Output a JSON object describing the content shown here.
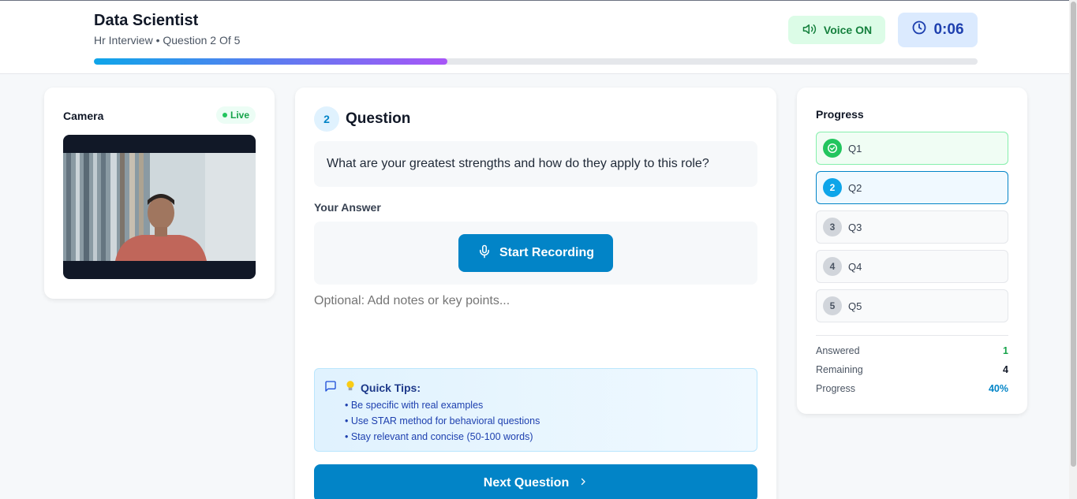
{
  "header": {
    "title": "Data Scientist",
    "subtitle": "Hr Interview • Question 2 Of 5",
    "voice_label": "Voice ON",
    "timer": "0:06",
    "progress_fraction": 0.4
  },
  "camera": {
    "label": "Camera",
    "status": "Live"
  },
  "question": {
    "number": "2",
    "heading": "Question",
    "text": "What are your greatest strengths and how do they apply to this role?",
    "answer_label": "Your Answer",
    "record_button": "Start Recording",
    "notes_placeholder": "Optional: Add notes or key points...",
    "tips_title": "Quick Tips:",
    "tips": [
      "• Be specific with real examples",
      "• Use STAR method for behavioral questions",
      "• Stay relevant and concise (50-100 words)"
    ],
    "next_button": "Next Question"
  },
  "progress": {
    "title": "Progress",
    "items": [
      {
        "num": "",
        "label": "Q1",
        "state": "done"
      },
      {
        "num": "2",
        "label": "Q2",
        "state": "current"
      },
      {
        "num": "3",
        "label": "Q3",
        "state": "pending"
      },
      {
        "num": "4",
        "label": "Q4",
        "state": "pending"
      },
      {
        "num": "5",
        "label": "Q5",
        "state": "pending"
      }
    ],
    "stats": [
      {
        "label": "Answered",
        "value": "1",
        "color": "#16a34a"
      },
      {
        "label": "Remaining",
        "value": "4",
        "color": "#111827"
      },
      {
        "label": "Progress",
        "value": "40%",
        "color": "#0284c7"
      }
    ]
  }
}
